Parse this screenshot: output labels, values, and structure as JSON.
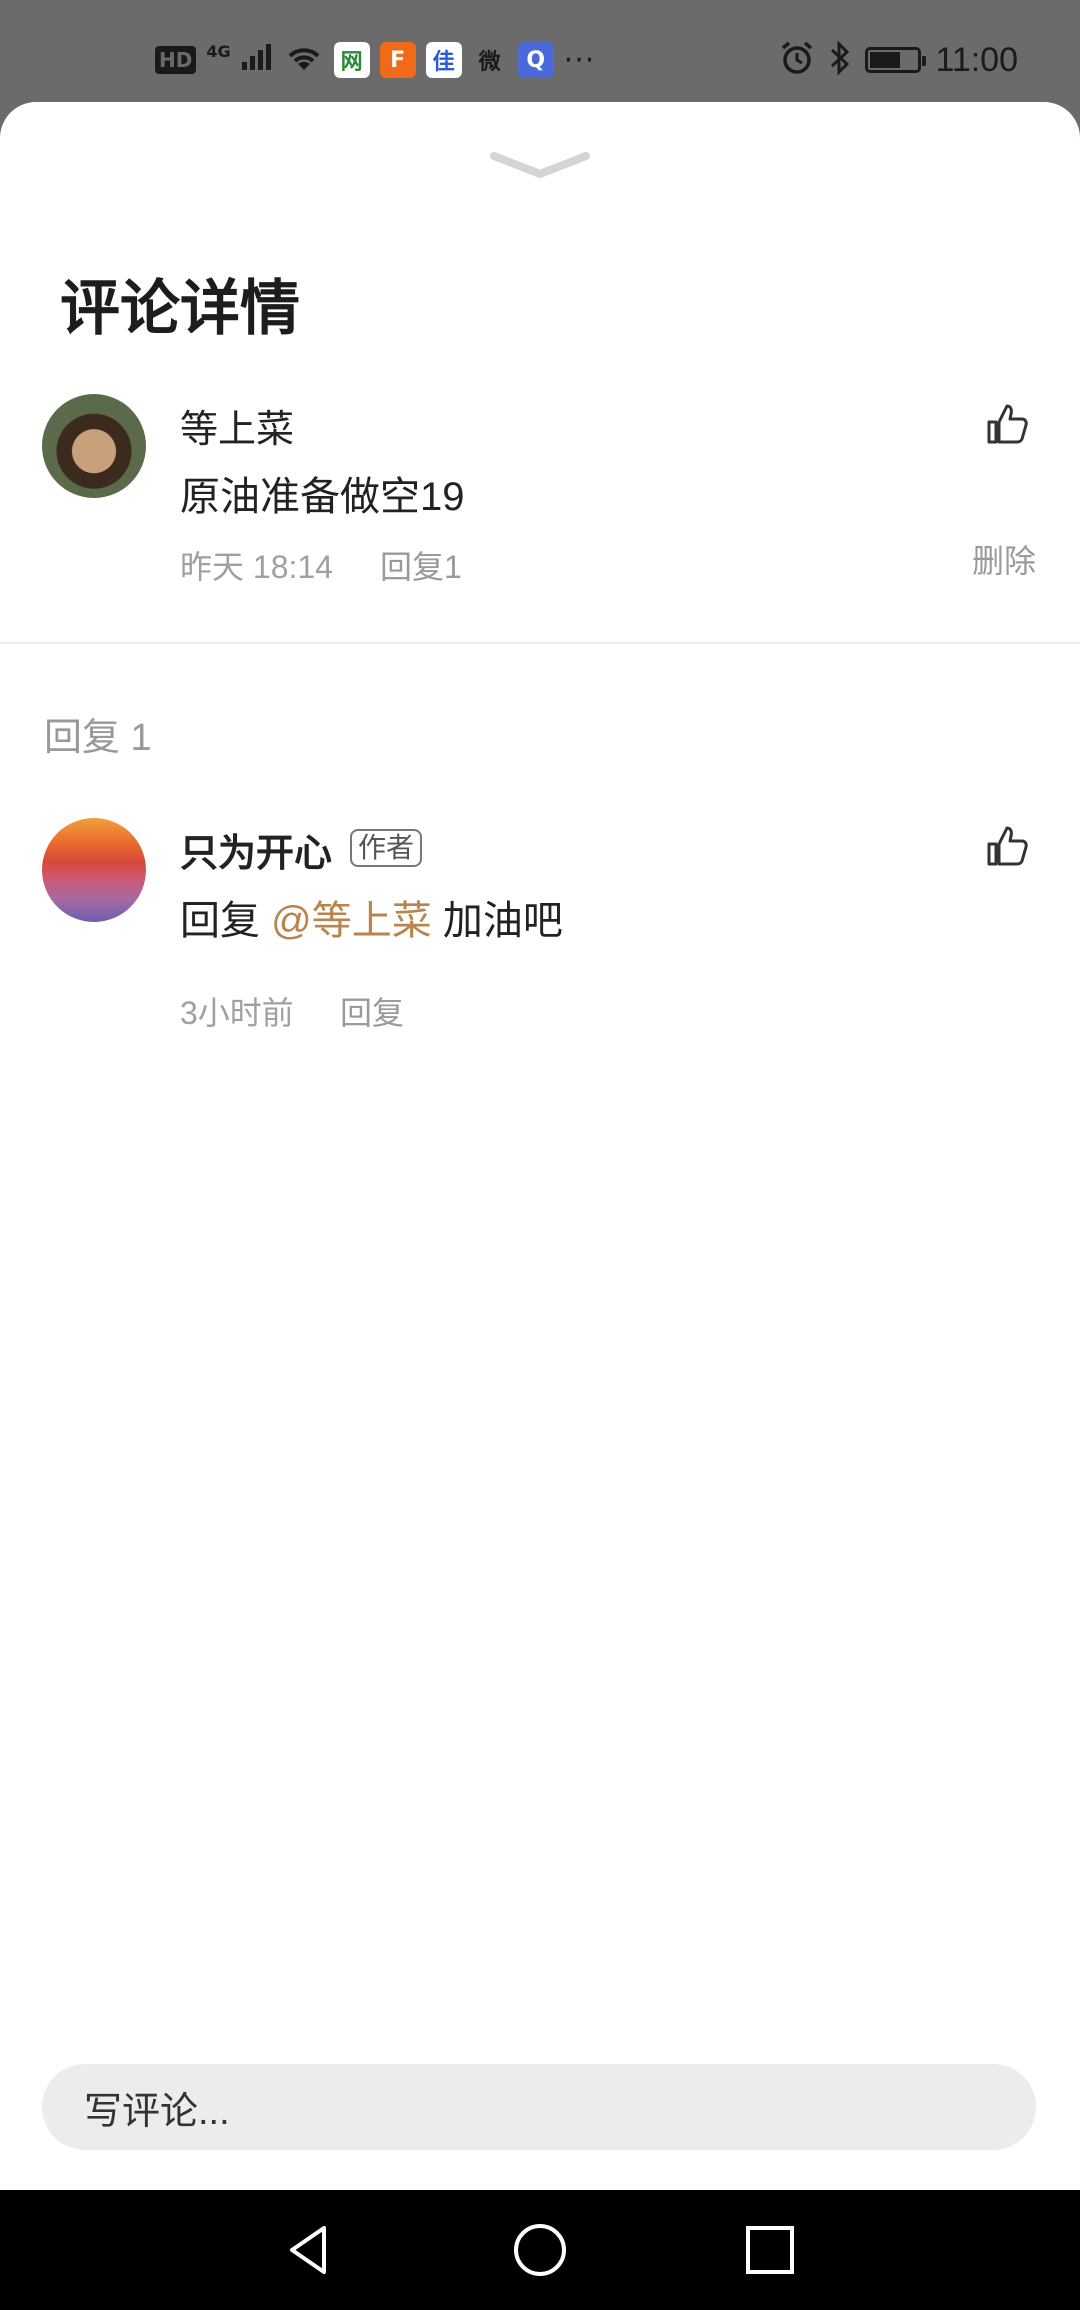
{
  "status_bar": {
    "left_badge": "HD",
    "signal": "4G",
    "apps": [
      "网",
      "F",
      "佳",
      "微",
      "Q"
    ],
    "more": "···",
    "time": "11:00"
  },
  "sheet": {
    "title": "评论详情"
  },
  "comment": {
    "user_name": "等上菜",
    "text": "原油准备做空19",
    "time": "昨天 18:14",
    "reply_label": "回复1",
    "delete_label": "删除"
  },
  "replies_section": {
    "header": "回复 1"
  },
  "reply": {
    "user_name": "只为开心",
    "author_tag": "作者",
    "prefix": "回复",
    "mention": "@等上菜",
    "text": "加油吧",
    "time": "3小时前",
    "reply_label": "回复"
  },
  "input": {
    "placeholder": "写评论..."
  },
  "colors": {
    "mention": "#b7854d",
    "meta": "#a0a0a0",
    "input_bg": "#ececec"
  }
}
